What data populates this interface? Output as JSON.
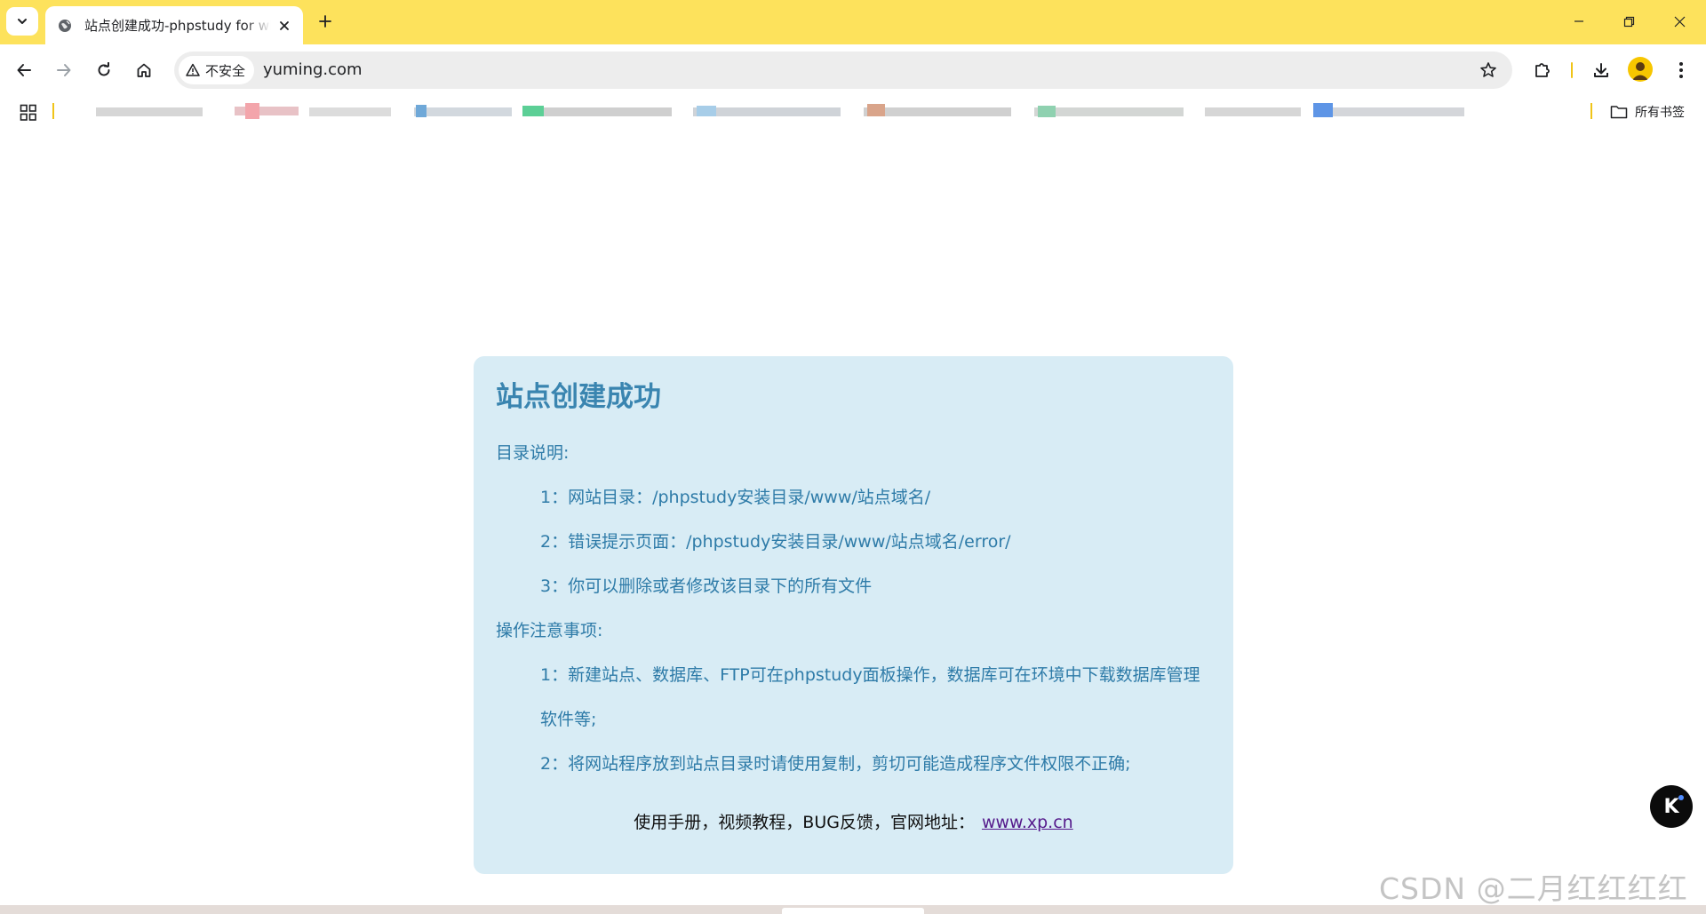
{
  "browser": {
    "tab": {
      "title": "站点创建成功-phpstudy for windows",
      "favicon": "globe-icon"
    },
    "tab_search_icon": "chevron-down-icon",
    "new_tab_icon": "plus-icon",
    "window_controls": [
      "minimize-icon",
      "restore-icon",
      "close-icon"
    ],
    "toolbar": {
      "back_icon": "arrow-left-icon",
      "forward_icon": "arrow-right-icon",
      "reload_icon": "reload-icon",
      "home_icon": "home-icon",
      "security_label": "不安全",
      "url": "yuming.com",
      "bookmark_star_icon": "star-icon",
      "extensions_icon": "puzzle-icon",
      "downloads_icon": "download-icon",
      "profile_icon": "avatar-icon",
      "menu_icon": "kebab-menu-icon"
    },
    "bookmarks_bar": {
      "apps_icon": "apps-grid-icon",
      "all_bookmarks_label": "所有书签"
    },
    "accent_color": "#fde25c"
  },
  "page": {
    "heading": "站点创建成功",
    "dir_title": "目录说明:",
    "dir_items": [
      "1：网站目录：/phpstudy安装目录/www/站点域名/",
      "2：错误提示页面：/phpstudy安装目录/www/站点域名/error/",
      "3：你可以删除或者修改该目录下的所有文件"
    ],
    "ops_title": "操作注意事项:",
    "ops_items": [
      "1：新建站点、数据库、FTP可在phpstudy面板操作，数据库可在环境中下载数据库管理软件等;",
      "2：将网站程序放到站点目录时请使用复制，剪切可能造成程序文件权限不正确;"
    ],
    "footer_text": "使用手册，视频教程，BUG反馈，官网地址：",
    "footer_link": "www.xp.cn",
    "card_color": "#d8ecf5",
    "heading_color": "#3a85b0",
    "text_color": "#2e7ba8"
  },
  "floating_button": {
    "glyph": "K",
    "icon": "assistant-icon"
  },
  "watermark": "CSDN @二月红红红红"
}
